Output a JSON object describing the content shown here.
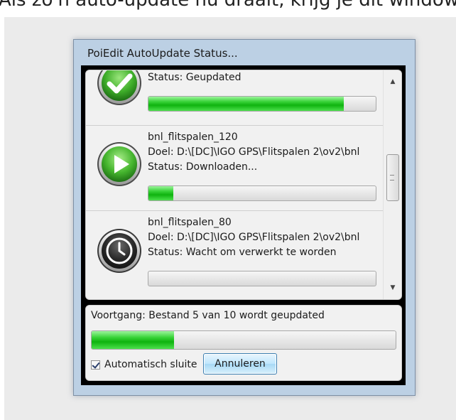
{
  "caption": "Als zo'n auto-update nu draait, krijg je dit window te zien:",
  "window": {
    "title": "PoiEdit AutoUpdate Status..."
  },
  "items": [
    {
      "icon": "checkmark-icon",
      "name": "",
      "target": "",
      "status": "Status: Geupdated",
      "progress": 0.86
    },
    {
      "icon": "play-icon",
      "name": "bnl_flitspalen_120",
      "target": "Doel: D:\\[DC]\\IGO GPS\\Flitspalen 2\\ov2\\bnl",
      "status": "Status: Downloaden...",
      "progress": 0.11
    },
    {
      "icon": "clock-icon",
      "name": "bnl_flitspalen_80",
      "target": "Doel: D:\\[DC]\\IGO GPS\\Flitspalen 2\\ov2\\bnl",
      "status": "Status: Wacht om verwerkt te worden",
      "progress": 0
    }
  ],
  "overall": {
    "label": "Voortgang: Bestand 5 van 10 wordt geupdated",
    "progress": 0.27
  },
  "auto_close": {
    "label": "Automatisch sluite",
    "checked": true
  },
  "cancel_label": "Annuleren",
  "colors": {
    "progress_green": "#1cc41c",
    "window_frame": "#bcd0e4",
    "button_border": "#3c7fb1"
  }
}
